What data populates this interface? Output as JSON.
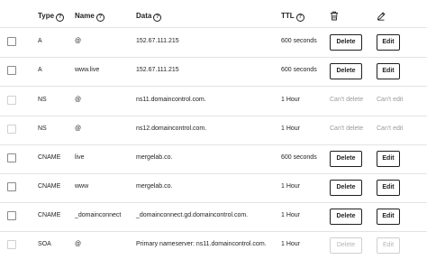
{
  "headers": {
    "type": "Type",
    "name": "Name",
    "data": "Data",
    "ttl": "TTL",
    "help_glyph": "?",
    "delete_icon": "trash-icon",
    "edit_icon": "pencil-icon"
  },
  "records": [
    {
      "type": "A",
      "name": "@",
      "data": "152.67.111.215",
      "ttl": "600 seconds",
      "delete": "Delete",
      "edit": "Edit"
    },
    {
      "type": "A",
      "name": "www.live",
      "data": "152.67.111.215",
      "ttl": "600 seconds",
      "delete": "Delete",
      "edit": "Edit"
    },
    {
      "type": "NS",
      "name": "@",
      "data": "ns11.domaincontrol.com.",
      "ttl": "1 Hour",
      "delete": "Can't delete",
      "edit": "Can't edit"
    },
    {
      "type": "NS",
      "name": "@",
      "data": "ns12.domaincontrol.com.",
      "ttl": "1 Hour",
      "delete": "Can't delete",
      "edit": "Can't edit"
    },
    {
      "type": "CNAME",
      "name": "live",
      "data": "mergelab.co.",
      "ttl": "600 seconds",
      "delete": "Delete",
      "edit": "Edit"
    },
    {
      "type": "CNAME",
      "name": "www",
      "data": "mergelab.co.",
      "ttl": "1 Hour",
      "delete": "Delete",
      "edit": "Edit"
    },
    {
      "type": "CNAME",
      "name": "_domainconnect",
      "data": "_domainconnect.gd.domaincontrol.com.",
      "ttl": "1 Hour",
      "delete": "Delete",
      "edit": "Edit"
    },
    {
      "type": "SOA",
      "name": "@",
      "data": "Primary nameserver: ns11.domaincontrol.com.",
      "ttl": "1 Hour",
      "delete": "Delete",
      "edit": "Edit"
    }
  ]
}
